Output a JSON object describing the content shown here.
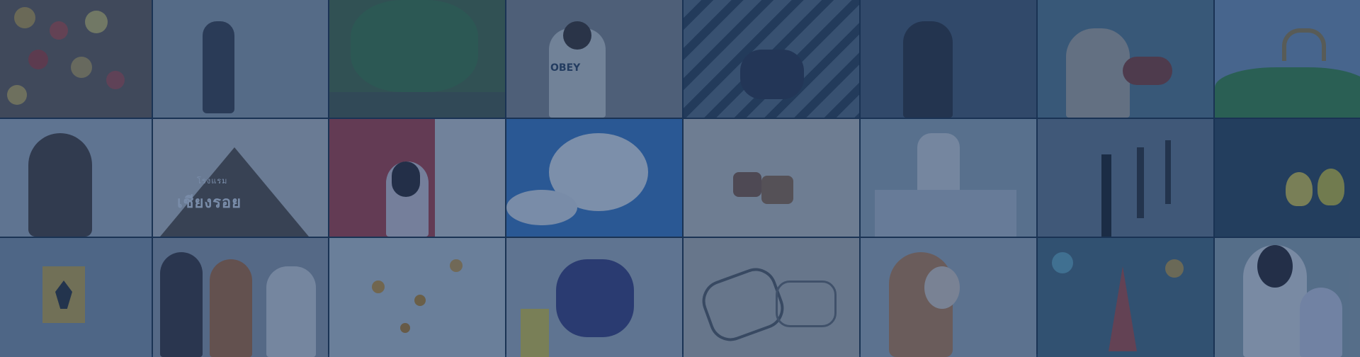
{
  "banner": {
    "tint_color": "#1e3c69",
    "grid": {
      "rows": 3,
      "columns": 8
    },
    "photos": [
      {
        "subject": "hanging-ornaments"
      },
      {
        "subject": "girl-walking-fog"
      },
      {
        "subject": "trees-park"
      },
      {
        "subject": "boy-on-scooter"
      },
      {
        "subject": "feet-on-stairs"
      },
      {
        "subject": "person-in-rain"
      },
      {
        "subject": "old-man-playing-violin"
      },
      {
        "subject": "garden-arch"
      },
      {
        "subject": "girl-profile-portrait"
      },
      {
        "subject": "hotel-sign"
      },
      {
        "subject": "girl-with-phone"
      },
      {
        "subject": "sky-clouds-windows"
      },
      {
        "subject": "sandals-on-sand"
      },
      {
        "subject": "street-vendor"
      },
      {
        "subject": "bollards-street"
      },
      {
        "subject": "rubber-ducks"
      },
      {
        "subject": "deer-sign-street"
      },
      {
        "subject": "three-girls"
      },
      {
        "subject": "wild-flowers"
      },
      {
        "subject": "girl-crouching"
      },
      {
        "subject": "drawing-in-sand"
      },
      {
        "subject": "girl-holding-leaf"
      },
      {
        "subject": "bokeh-ornament"
      },
      {
        "subject": "mother-and-baby"
      }
    ],
    "sign_text_thai": "เชียงรอย",
    "sign_text_small": "โรงแรม",
    "shirt_text": "OBEY"
  }
}
